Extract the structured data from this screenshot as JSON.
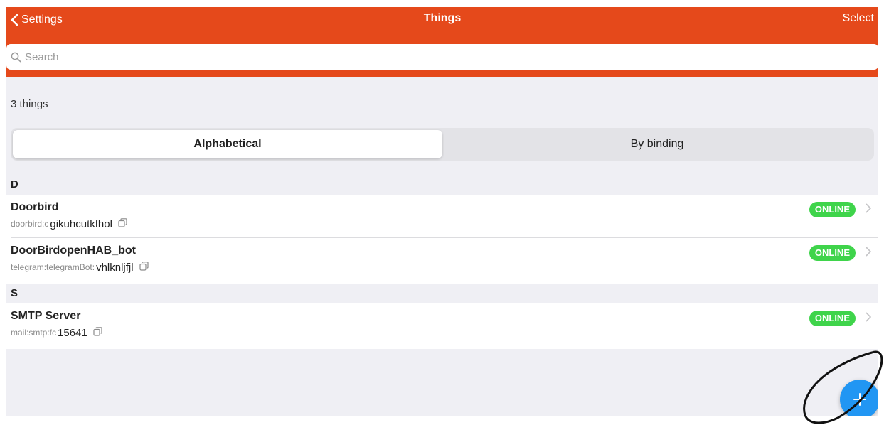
{
  "navbar": {
    "back_label": "Settings",
    "title": "Things",
    "select_label": "Select"
  },
  "search": {
    "placeholder": "Search",
    "value": ""
  },
  "count_text": "3 things",
  "segments": [
    {
      "label": "Alphabetical",
      "active": true
    },
    {
      "label": "By binding",
      "active": false
    }
  ],
  "sections": [
    {
      "letter": "D",
      "items": [
        {
          "title": "Doorbird",
          "subtitle_prefix": "doorbird:c",
          "subtitle_visible": "gikuhcutkfhol",
          "status": "ONLINE"
        },
        {
          "title": "DoorBirdopenHAB_bot",
          "subtitle_prefix": "telegram:telegramBot:",
          "subtitle_visible": "vhlknljfjl",
          "status": "ONLINE"
        }
      ]
    },
    {
      "letter": "S",
      "items": [
        {
          "title": "SMTP Server",
          "subtitle_prefix": "mail:smtp:fc",
          "subtitle_visible": "15641",
          "status": "ONLINE"
        }
      ]
    }
  ],
  "colors": {
    "accent": "#e5491b",
    "online": "#3fd44b",
    "fab": "#2196f3",
    "background": "#efeff4"
  },
  "icons": {
    "back": "chevron-left-icon",
    "search": "search-icon",
    "copy": "copy-icon",
    "chevron": "chevron-right-icon",
    "fab": "plus-icon"
  }
}
